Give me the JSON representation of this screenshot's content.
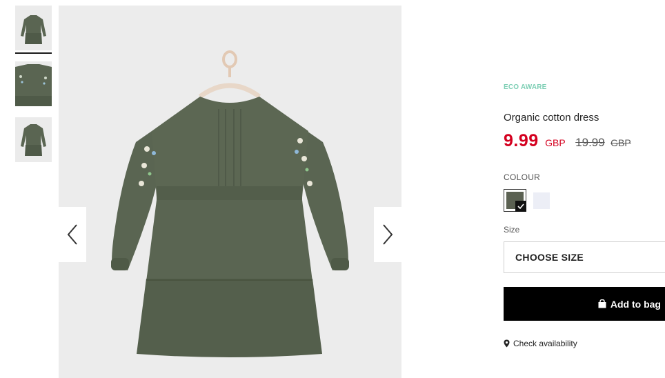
{
  "thumbnails": [
    {
      "label": "Front view",
      "active": true
    },
    {
      "label": "Detail view",
      "active": false
    },
    {
      "label": "Back view",
      "active": false
    }
  ],
  "product": {
    "badge": "ECO AWARE",
    "name": "Organic cotton dress",
    "price_current": "9.99",
    "price_currency": "GBP",
    "price_old": "19.99",
    "price_old_currency": "GBP"
  },
  "colour": {
    "label": "COLOUR",
    "swatches": [
      {
        "name": "khaki",
        "color": "#5b6152",
        "selected": true
      },
      {
        "name": "light",
        "color": "#eceef6",
        "selected": false
      }
    ]
  },
  "size": {
    "label": "Size",
    "placeholder": "CHOOSE SIZE"
  },
  "actions": {
    "add_to_bag": "Add to bag",
    "check_availability": "Check availability"
  },
  "colors": {
    "price_red": "#d4001f",
    "eco_green": "#7ecfb5",
    "dress": "#5a6552"
  }
}
